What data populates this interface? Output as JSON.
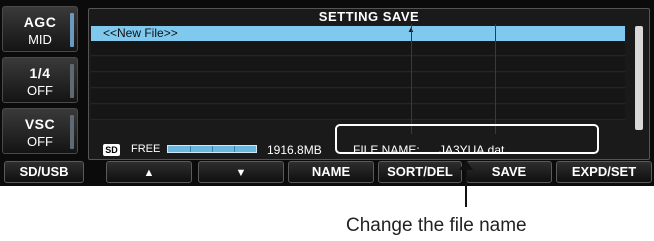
{
  "side_buttons": [
    {
      "label": "AGC",
      "value": "MID"
    },
    {
      "label": "1/4",
      "value": "OFF"
    },
    {
      "label": "VSC",
      "value": "OFF"
    }
  ],
  "panel": {
    "title": "SETTING SAVE",
    "selected_row": "<<New File>>"
  },
  "footer": {
    "sd_badge": "SD",
    "free_label": "FREE",
    "free_value": "1916.8MB",
    "file_name_label": "FILE NAME:",
    "file_name_value": "JA3YUA.dat"
  },
  "softkeys": {
    "sd_usb": "SD/USB",
    "name": "NAME",
    "sort_del": "SORT/DEL",
    "save": "SAVE",
    "expd_set": "EXPD/SET"
  },
  "icons": {
    "up": "up-arrow-icon",
    "down": "down-arrow-icon"
  },
  "colors": {
    "selection": "#7fc9ee",
    "screen_bg": "#0b0b0b",
    "capacity_bar": "#6bb7e0"
  },
  "callout": {
    "text": "Change the file name"
  }
}
